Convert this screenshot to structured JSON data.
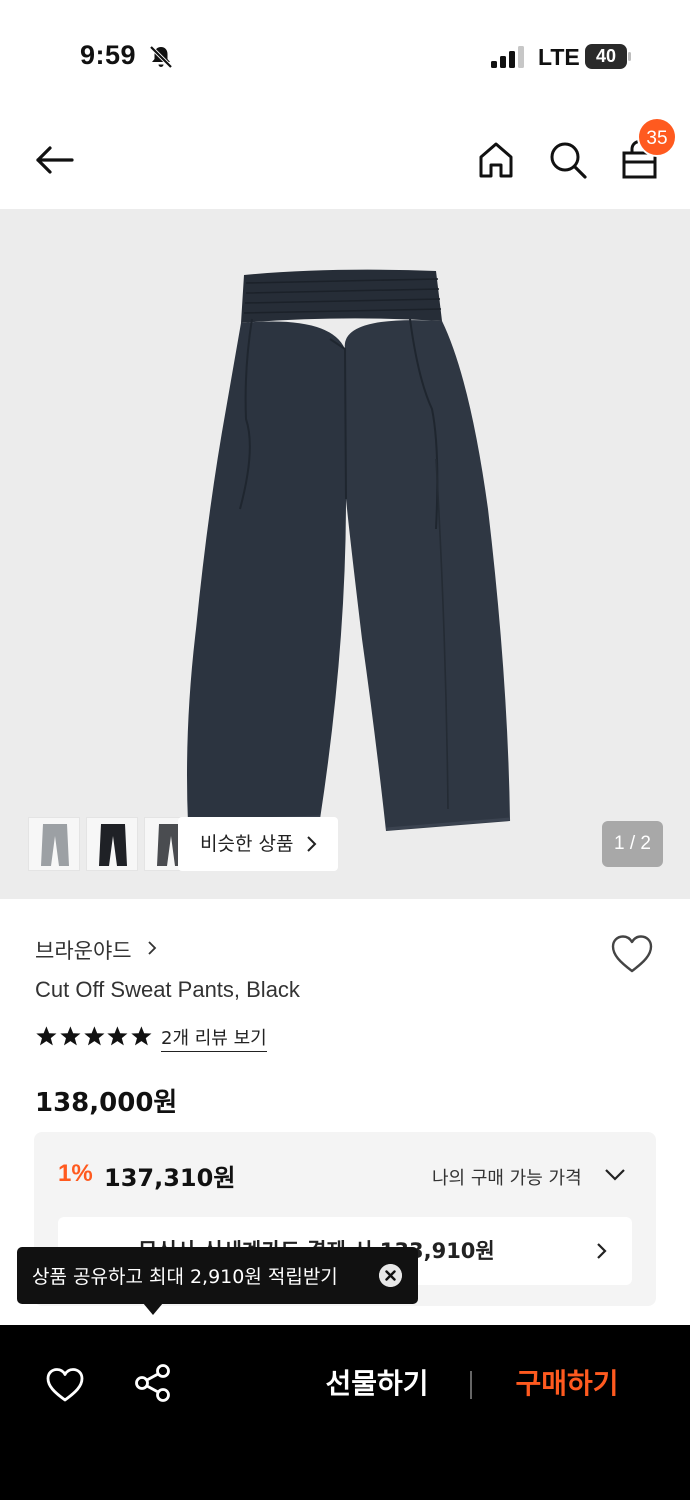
{
  "status_bar": {
    "time": "9:59",
    "network": "LTE",
    "battery": "40",
    "icons": [
      "bell-off-icon",
      "signal-icon",
      "battery-icon"
    ]
  },
  "nav": {
    "icons": [
      "back-arrow-icon",
      "home-icon",
      "search-icon",
      "shopping-bag-icon"
    ],
    "cart_count": "35",
    "badge_color": "#ff5a1f"
  },
  "gallery": {
    "similar_label": "비슷한 상품",
    "page_indicator": "1 / 2",
    "thumbnails": [
      "gray-pants",
      "black-pants",
      "charcoal-pants"
    ]
  },
  "product": {
    "brand": "브라운야드",
    "name": "Cut Off Sweat Pants, Black",
    "rating": 5,
    "review_link": "2개 리뷰 보기",
    "price": "138,000원"
  },
  "discount": {
    "rate": "1%",
    "price": "137,310원",
    "available_label": "나의 구매 가능 가격",
    "card_text": "무신사 신세계카드 결제 시 133,910원",
    "accent_color": "#ff5a1f"
  },
  "tooltip": {
    "text": "상품 공유하고 최대 2,910원 적립받기"
  },
  "bottom_bar": {
    "gift_label": "선물하기",
    "buy_label": "구매하기",
    "buy_color": "#ff5a1f"
  }
}
